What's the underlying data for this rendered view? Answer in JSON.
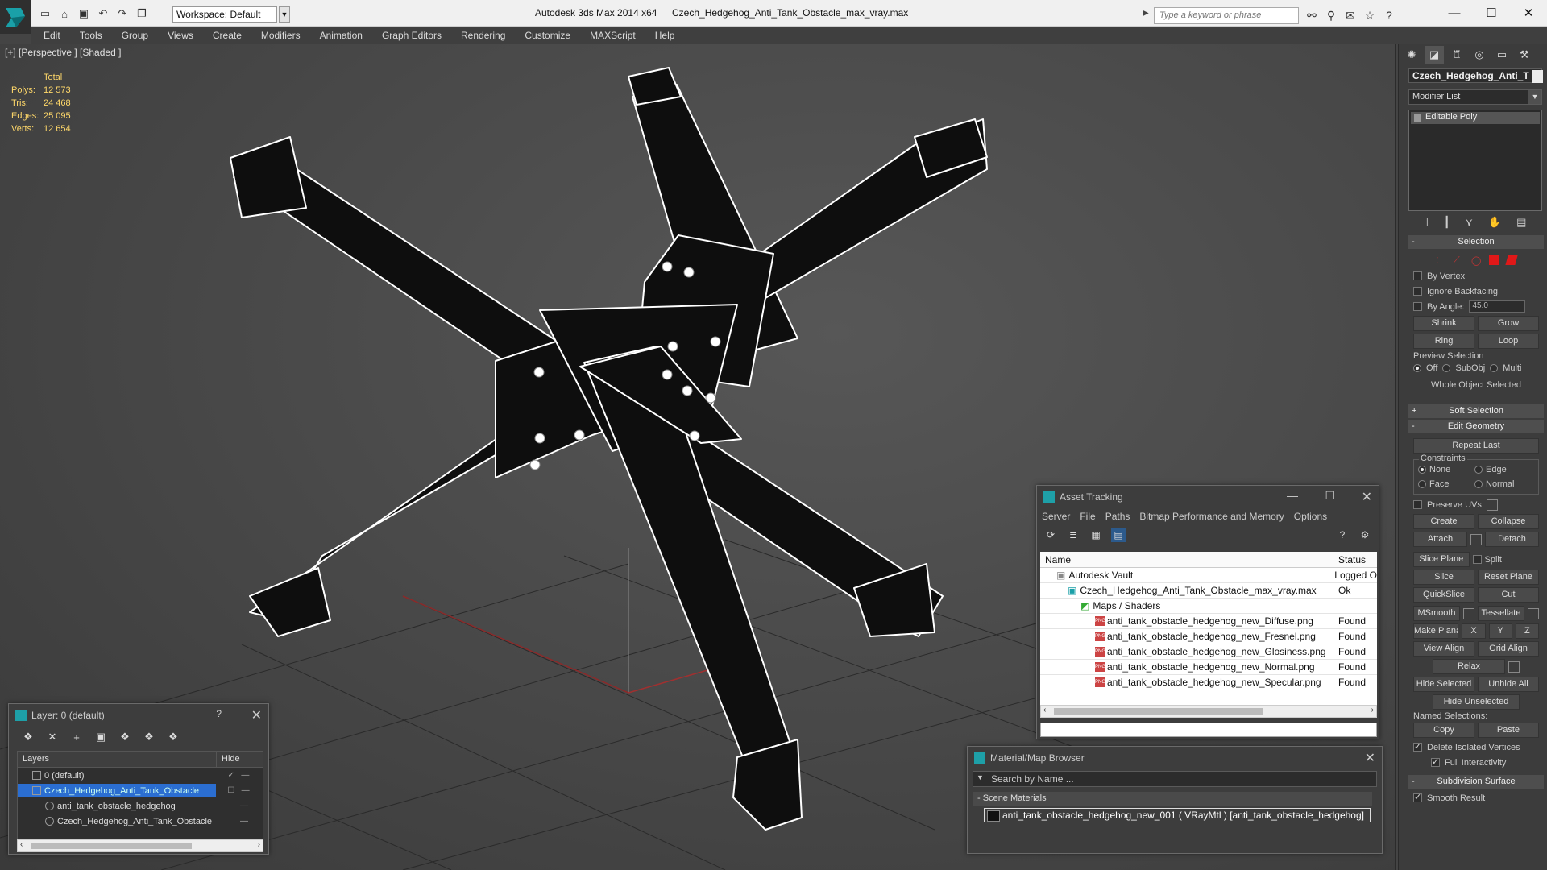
{
  "titlebar": {
    "workspace": "Workspace: Default",
    "app_title": "Autodesk 3ds Max  2014 x64",
    "file_title": "Czech_Hedgehog_Anti_Tank_Obstacle_max_vray.max",
    "search_placeholder": "Type a keyword or phrase"
  },
  "menu": [
    "Edit",
    "Tools",
    "Group",
    "Views",
    "Create",
    "Modifiers",
    "Animation",
    "Graph Editors",
    "Rendering",
    "Customize",
    "MAXScript",
    "Help"
  ],
  "viewport": {
    "label": "[+] [Perspective ] [Shaded ]",
    "stats": {
      "header": "Total",
      "rows": [
        {
          "k": "Polys:",
          "v": "12 573"
        },
        {
          "k": "Tris:",
          "v": "24 468"
        },
        {
          "k": "Edges:",
          "v": "25 095"
        },
        {
          "k": "Verts:",
          "v": "12 654"
        }
      ]
    }
  },
  "command_panel": {
    "object_name": "Czech_Hedgehog_Anti_T",
    "modifier_list": "Modifier List",
    "stack_item": "Editable Poly",
    "selection": {
      "title": "Selection",
      "by_vertex": "By Vertex",
      "ignore_backfacing": "Ignore Backfacing",
      "by_angle": "By Angle:",
      "angle_value": "45.0",
      "shrink": "Shrink",
      "grow": "Grow",
      "ring": "Ring",
      "loop": "Loop",
      "preview_selection": "Preview Selection",
      "preview_opts": [
        "Off",
        "SubObj",
        "Multi"
      ],
      "whole_object": "Whole Object Selected"
    },
    "soft_selection": "Soft Selection",
    "edit_geometry": {
      "title": "Edit Geometry",
      "repeat_last": "Repeat Last",
      "constraints": "Constraints",
      "c_none": "None",
      "c_edge": "Edge",
      "c_face": "Face",
      "c_normal": "Normal",
      "preserve_uvs": "Preserve UVs",
      "create": "Create",
      "collapse": "Collapse",
      "attach": "Attach",
      "detach": "Detach",
      "slice_plane": "Slice Plane",
      "split": "Split",
      "slice": "Slice",
      "reset_plane": "Reset Plane",
      "quickslice": "QuickSlice",
      "cut": "Cut",
      "msmooth": "MSmooth",
      "tessellate": "Tessellate",
      "make_planar": "Make Planar",
      "x": "X",
      "y": "Y",
      "z": "Z",
      "view_align": "View Align",
      "grid_align": "Grid Align",
      "relax": "Relax",
      "hide_selected": "Hide Selected",
      "unhide_all": "Unhide All",
      "hide_unselected": "Hide Unselected",
      "named_selections": "Named Selections:",
      "copy": "Copy",
      "paste": "Paste",
      "delete_isolated": "Delete Isolated Vertices",
      "full_interactivity": "Full Interactivity"
    },
    "subdivision_surface": "Subdivision Surface",
    "smooth_result": "Smooth Result"
  },
  "asset_tracking": {
    "title": "Asset Tracking",
    "menu": [
      "Server",
      "File",
      "Paths",
      "Bitmap Performance and Memory",
      "Options"
    ],
    "col_name": "Name",
    "col_status": "Status",
    "rows": [
      {
        "name": "Autodesk Vault",
        "status": "Logged O",
        "indent": 0
      },
      {
        "name": "Czech_Hedgehog_Anti_Tank_Obstacle_max_vray.max",
        "status": "Ok",
        "indent": 1
      },
      {
        "name": "Maps / Shaders",
        "status": "",
        "indent": 2
      },
      {
        "name": "anti_tank_obstacle_hedgehog_new_Diffuse.png",
        "status": "Found",
        "indent": 3
      },
      {
        "name": "anti_tank_obstacle_hedgehog_new_Fresnel.png",
        "status": "Found",
        "indent": 3
      },
      {
        "name": "anti_tank_obstacle_hedgehog_new_Glosiness.png",
        "status": "Found",
        "indent": 3
      },
      {
        "name": "anti_tank_obstacle_hedgehog_new_Normal.png",
        "status": "Found",
        "indent": 3
      },
      {
        "name": "anti_tank_obstacle_hedgehog_new_Specular.png",
        "status": "Found",
        "indent": 3
      }
    ]
  },
  "material_browser": {
    "title": "Material/Map Browser",
    "search": "Search by Name ...",
    "section": "Scene Materials",
    "item": "anti_tank_obstacle_hedgehog_new_001 ( VRayMtl ) [anti_tank_obstacle_hedgehog]"
  },
  "layer_dialog": {
    "title": "Layer: 0 (default)",
    "help": "?",
    "col_layers": "Layers",
    "col_hide": "Hide",
    "rows": [
      {
        "name": "0 (default)",
        "indent": 1
      },
      {
        "name": "Czech_Hedgehog_Anti_Tank_Obstacle",
        "indent": 1
      },
      {
        "name": "anti_tank_obstacle_hedgehog",
        "indent": 2
      },
      {
        "name": "Czech_Hedgehog_Anti_Tank_Obstacle",
        "indent": 2
      }
    ]
  }
}
